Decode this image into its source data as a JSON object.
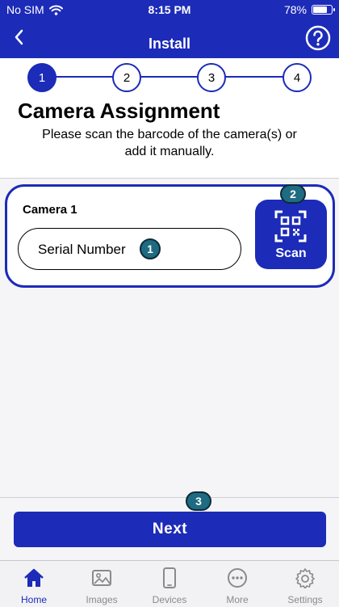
{
  "status_bar": {
    "carrier": "No SIM",
    "time": "8:15 PM",
    "battery": "78%",
    "battery_level": 0.78
  },
  "nav": {
    "title": "Install"
  },
  "stepper": {
    "steps": [
      "1",
      "2",
      "3",
      "4"
    ],
    "active": 1
  },
  "intro": {
    "title": "Camera Assignment",
    "subtitle_line1": "Please scan the barcode of the camera(s) or",
    "subtitle_line2": "add it manually."
  },
  "camera": {
    "label": "Camera 1",
    "serial_placeholder": "Serial Number",
    "scan_label": "Scan"
  },
  "callouts": {
    "serial": "1",
    "scan": "2",
    "next": "3"
  },
  "footer": {
    "next_label": "Next"
  },
  "tabs": [
    {
      "label": "Home",
      "icon": "home-icon",
      "active": true
    },
    {
      "label": "Images",
      "icon": "images-icon",
      "active": false
    },
    {
      "label": "Devices",
      "icon": "devices-icon",
      "active": false
    },
    {
      "label": "More",
      "icon": "more-icon",
      "active": false
    },
    {
      "label": "Settings",
      "icon": "settings-icon",
      "active": false
    }
  ],
  "colors": {
    "primary": "#1c2bb8",
    "callout": "#1e6b82",
    "background": "#f5f5f7"
  }
}
